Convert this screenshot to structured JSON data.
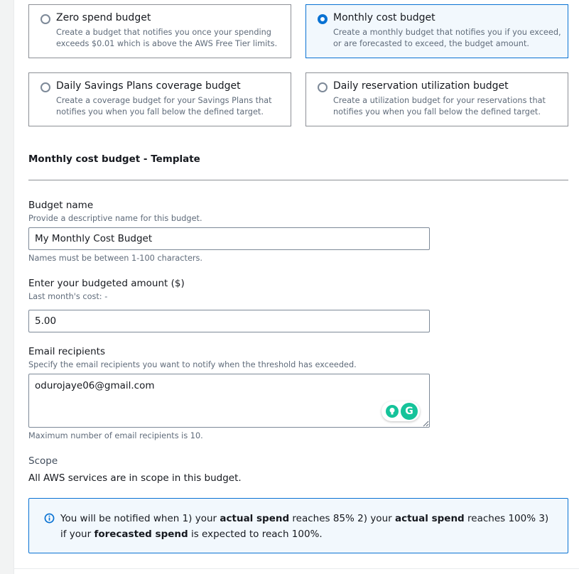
{
  "budget_types": [
    {
      "title": "Zero spend budget",
      "description": "Create a budget that notifies you once your spending exceeds $0.01 which is above the AWS Free Tier limits.",
      "selected": false
    },
    {
      "title": "Monthly cost budget",
      "description": "Create a monthly budget that notifies you if you exceed, or are forecasted to exceed, the budget amount.",
      "selected": true
    },
    {
      "title": "Daily Savings Plans coverage budget",
      "description": "Create a coverage budget for your Savings Plans that notifies you when you fall below the defined target.",
      "selected": false
    },
    {
      "title": "Daily reservation utilization budget",
      "description": "Create a utilization budget for your reservations that notifies you when you fall below the defined target.",
      "selected": false
    }
  ],
  "template": {
    "title": "Monthly cost budget - Template"
  },
  "budget_name": {
    "label": "Budget name",
    "description": "Provide a descriptive name for this budget.",
    "value": "My Monthly Cost Budget",
    "constraint": "Names must be between 1-100 characters."
  },
  "budget_amount": {
    "label": "Enter your budgeted amount ($)",
    "description": "Last month's cost: -",
    "value": "5.00"
  },
  "email_recipients": {
    "label": "Email recipients",
    "description": "Specify the email recipients you want to notify when the threshold has exceeded.",
    "value": "odurojaye06@gmail.com",
    "constraint": "Maximum number of email recipients is 10."
  },
  "scope": {
    "label": "Scope",
    "text": "All AWS services are in scope in this budget."
  },
  "alert": {
    "part1": "You will be notified when 1) your ",
    "bold1": "actual spend",
    "part2": " reaches 85% 2) your ",
    "bold2": "actual spend",
    "part3": " reaches 100% 3) if your ",
    "bold3": "forecasted spend",
    "part4": " is expected to reach 100%."
  },
  "grammarly": {
    "logo_letter": "G"
  },
  "colors": {
    "accent": "#0972d3",
    "selected_bg": "#f2f8fd",
    "grammarly": "#15c39a"
  }
}
